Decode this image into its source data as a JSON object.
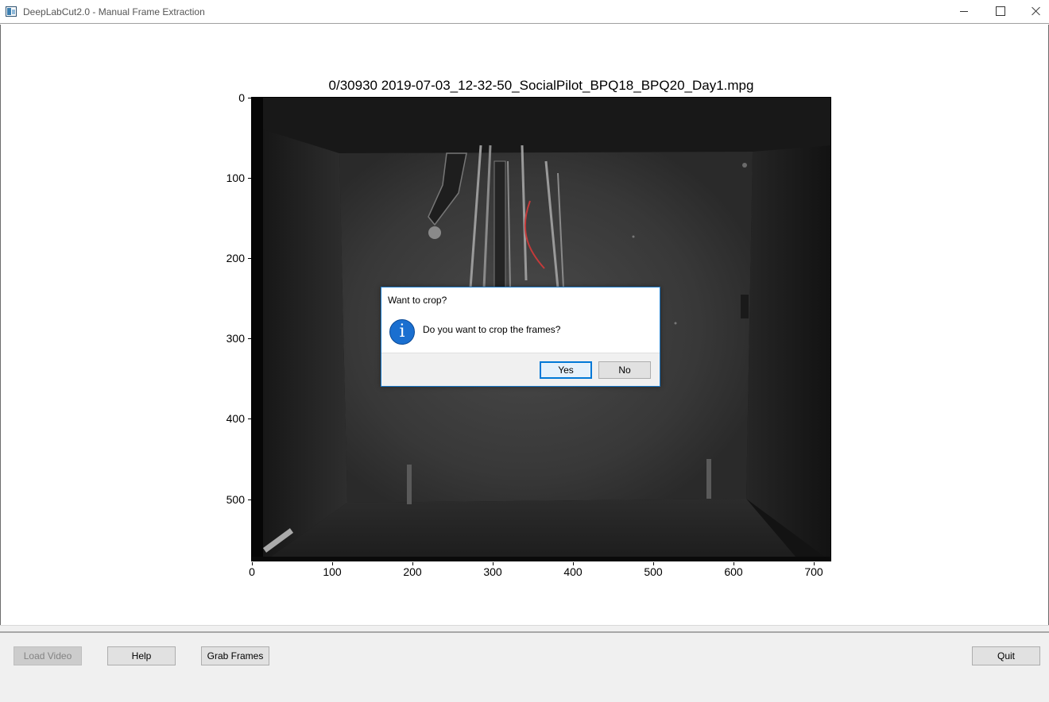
{
  "window": {
    "title": "DeepLabCut2.0 - Manual Frame Extraction"
  },
  "plot": {
    "title": "0/30930 2019-07-03_12-32-50_SocialPilot_BPQ18_BPQ20_Day1.mpg",
    "yticks": [
      "0",
      "100",
      "200",
      "300",
      "400",
      "500"
    ],
    "xticks": [
      "0",
      "100",
      "200",
      "300",
      "400",
      "500",
      "600",
      "700"
    ]
  },
  "dialog": {
    "title": "Want to crop?",
    "message": "Do you want to crop the frames?",
    "icon": "info-icon",
    "yes_label": "Yes",
    "no_label": "No"
  },
  "controls": {
    "load_video": "Load Video",
    "help": "Help",
    "grab_frames": "Grab Frames",
    "quit": "Quit"
  }
}
